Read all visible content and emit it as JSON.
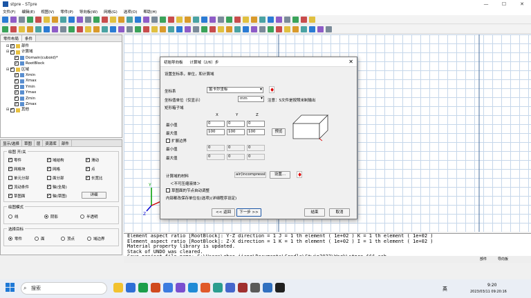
{
  "window": {
    "title": "stpre - STpre",
    "minimize": "—",
    "maximize": "☐",
    "close": "✕"
  },
  "menu": [
    "文件(F)",
    "编辑(E)",
    "视图(V)",
    "零件(P)",
    "导向板(W)",
    "网格(G)",
    "选项(O)",
    "帮助(H)"
  ],
  "left_panel": {
    "tabs": [
      "零件布局",
      "条件"
    ],
    "tree": [
      {
        "label": "部件",
        "level": 1,
        "checked": true
      },
      {
        "label": "计算域",
        "level": 1,
        "checked": true
      },
      {
        "label": "Domain(cuboid)*",
        "level": 2,
        "checked": true
      },
      {
        "label": "RootBlock",
        "level": 2,
        "checked": true
      },
      {
        "label": "区域",
        "level": 1,
        "checked": true
      },
      {
        "label": "Xmin",
        "level": 2,
        "checked": true
      },
      {
        "label": "Xmax",
        "level": 2,
        "checked": true
      },
      {
        "label": "Ymin",
        "level": 2,
        "checked": true
      },
      {
        "label": "Ymax",
        "level": 2,
        "checked": true
      },
      {
        "label": "Zmin",
        "level": 2,
        "checked": true
      },
      {
        "label": "Zmax",
        "level": 2,
        "checked": true
      },
      {
        "label": "其他",
        "level": 1,
        "checked": true
      }
    ]
  },
  "left_bottom": {
    "tabs": [
      "显示/选择",
      "草图",
      "层",
      "资源库",
      "部件"
    ],
    "switch_group": {
      "title": "绘图 开/关",
      "items": [
        {
          "label": "零件",
          "checked": true
        },
        {
          "label": "域结构",
          "checked": true
        },
        {
          "label": "滑动",
          "checked": true
        },
        {
          "label": "网格块",
          "checked": true
        },
        {
          "label": "网格",
          "checked": true
        },
        {
          "label": "点",
          "checked": true
        },
        {
          "label": "单元分部",
          "checked": false
        },
        {
          "label": "面分部",
          "checked": false
        },
        {
          "label": "长宽比",
          "checked": true
        },
        {
          "label": "流动条件",
          "checked": true
        },
        {
          "label": "轴(全局)",
          "checked": true
        },
        {
          "label": "",
          "checked": false
        },
        {
          "label": "草图面",
          "checked": true
        },
        {
          "label": "轴(草图)",
          "checked": true
        }
      ],
      "detail_button": "详细"
    },
    "mode_group": {
      "title": "绘图模式",
      "options": [
        "线",
        "阴影",
        "半透明"
      ],
      "selected": 1
    },
    "target_group": {
      "title": "选择目标",
      "options": [
        "零件",
        "面",
        "顶点",
        "域边界"
      ],
      "selected": 0
    }
  },
  "dialog": {
    "title": "初始导向板",
    "step": "计算域（2/6）步",
    "subtitle": "设置坐标系，单位，和计算域",
    "coord_label": "坐标系",
    "coord_value": "笛卡尔坐标",
    "unit_label": "坐标值单位（仅显示）",
    "unit_value": "mm",
    "unit_note": "注意：S文件是按照米制输出",
    "domain_label": "矩形箱子域",
    "col_headers": [
      "X",
      "Y",
      "Z"
    ],
    "min_label": "最小值",
    "max_label": "最大值",
    "min_values": [
      "0",
      "0",
      "0"
    ],
    "max_values": [
      "100",
      "100",
      "100"
    ],
    "preview_button": "预览",
    "extend_label": "扩展边界",
    "ext_min_label": "最小值",
    "ext_max_label": "最大值",
    "ext_min_values": [
      "0",
      "0",
      "0"
    ],
    "ext_max_values": [
      "0",
      "0",
      "0"
    ],
    "material_label": "计算域的材料",
    "material_value": "air(incompressibl",
    "material_button": "设置...",
    "material_note": "＜不可压缩液体＞",
    "refine_label": "草图面的节点自动调整",
    "save_note": "内部都改保存单位在(选项)(详细程序设定)",
    "back_button": "<< 返回",
    "next_button": "下一步 >>",
    "finish_button": "结束",
    "cancel_button": "取消"
  },
  "console": [
    "Element aspect ratio [RootBlock]: Y-Z direction = 1 J = 1 th element ( 1e+02 ) K = 1 th element ( 1e+02 )",
    "Element aspect ratio [RootBlock]: Z-X direction = 1 K = 1 th element ( 1e+02 ) I = 1 th element ( 1e+02 )",
    "Material property library is updated.",
    "Stack of UNDO was cleared.",
    "Save project file name: C:\\Users\\zhao.jiang\\Documents\\Cradle\\Stwin2022\\Work\\stpre_$$$.cab",
    "Operation Start"
  ],
  "status": {
    "left": "部件",
    "right": "导向板"
  },
  "taskbar": {
    "search": "搜索",
    "ime": "英",
    "time": "9:20",
    "date": "2023/03/11 09:20:16"
  },
  "colors": {
    "grid": "#c6d7ea",
    "accent": "#1a55a5",
    "pin": "#dd0000"
  }
}
